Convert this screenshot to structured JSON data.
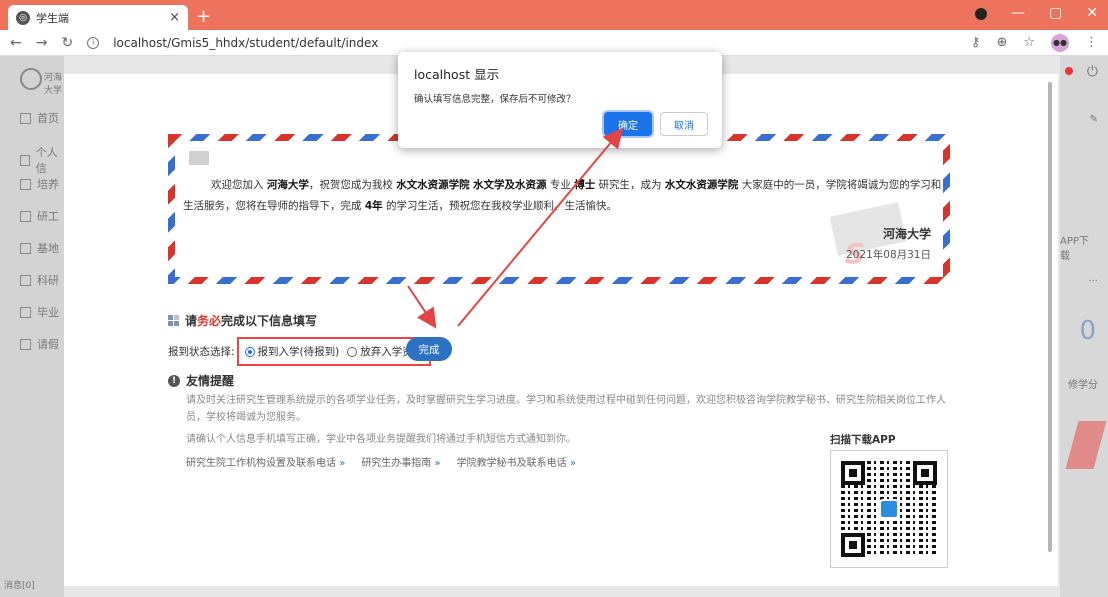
{
  "browser": {
    "tab_title": "学生端",
    "url": "localhost/Gmis5_hhdx/student/default/index"
  },
  "sidebar": {
    "logo_text": "河海大学",
    "items": [
      {
        "label": "首页"
      },
      {
        "label": "个人信"
      },
      {
        "label": "培养"
      },
      {
        "label": "研工"
      },
      {
        "label": "基地"
      },
      {
        "label": "科研"
      },
      {
        "label": "毕业"
      },
      {
        "label": "请假"
      }
    ],
    "bottom_text": "消息[0]"
  },
  "right_panel": {
    "app_download": "APP下载",
    "score": "0",
    "score_label": "修学分"
  },
  "welcome": {
    "text_parts": [
      "欢迎您加入 ",
      "河海大学",
      "，祝贺您成为我校 ",
      "水文水资源学院",
      " ",
      "水文学及水资源",
      " 专业 ",
      "博士",
      " 研究生，成为 ",
      "水文水资源学院",
      " 大家庭中的一员，学院将竭诚为您的学习和生活服务，您将在导师的指导下，完成 ",
      "4年",
      " 的学习生活，预祝您在我校学业顺利、生活愉快。"
    ],
    "university": "河海大学",
    "date": "2021年08月31日"
  },
  "form": {
    "title_prefix": "请",
    "title_emphasis": "务必",
    "title_suffix": "完成以下信息填写",
    "status_label": "报到状态选择:",
    "option_register": "报到入学(待报到)",
    "option_abandon": "放弃入学资格",
    "selected": "option_register",
    "submit_label": "完成"
  },
  "tips": {
    "title": "友情提醒",
    "line1": "请及时关注研究生管理系统提示的各项学业任务，及时掌握研究生学习进度。学习和系统使用过程中碰到任何问题，欢迎您积极咨询学院教学秘书、研究生院相关岗位工作人员，学校将竭诚为您服务。",
    "line2": "请确认个人信息手机填写正确，学业中各项业务提醒我们将通过手机短信方式通知到你。",
    "links": [
      {
        "label": "研究生院工作机构设置及联系电话"
      },
      {
        "label": "研究生办事指南"
      },
      {
        "label": "学院教学秘书及联系电话"
      }
    ],
    "link_chevron": "»"
  },
  "qr": {
    "label": "扫描下载APP"
  },
  "alert": {
    "title": "localhost 显示",
    "message": "确认填写信息完整，保存后不可修改？",
    "ok_label": "确定",
    "cancel_label": "取消"
  },
  "colors": {
    "tabbar": "#ee735d",
    "primary": "#2c71c2",
    "alert_primary": "#1a73e8",
    "emphasis": "#e23a2a",
    "annotation": "#e44444"
  }
}
